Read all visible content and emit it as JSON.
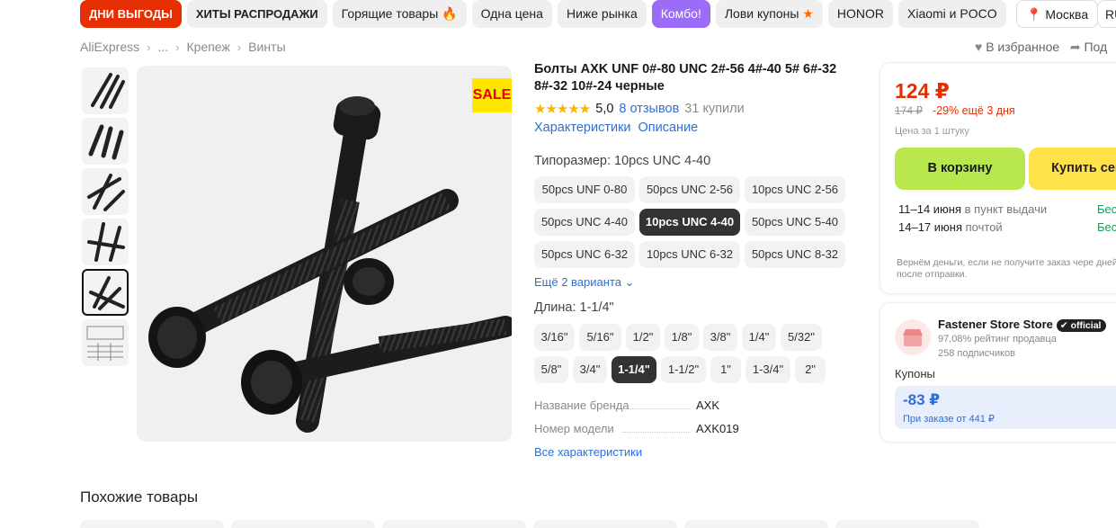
{
  "topnav": {
    "chips": [
      "ДНИ ВЫГОДЫ",
      "ХИТЫ РАСПРОДАЖИ",
      "Горящие товары",
      "Одна цена",
      "Ниже рынка",
      "Комбо!",
      "Лови купоны",
      "HONOR",
      "Xiaomi и POCO"
    ],
    "location": "Москва",
    "lang": "RU"
  },
  "breadcrumb": [
    "AliExpress",
    "...",
    "Крепеж",
    "Винты"
  ],
  "actions": {
    "favorite": "В избранное",
    "share": "Под"
  },
  "gallery": {
    "sale_badge": "SALE",
    "thumb_count": 6,
    "active_thumb": 4
  },
  "product": {
    "title": "Болты AXK UNF 0#-80 UNC 2#-56 4#-40 5# 6#-32 8#-32 10#-24 черные",
    "rating_stars": "★★★★★",
    "rating": "5,0",
    "reviews": "8 отзывов",
    "bought": "31 купили",
    "tabs": [
      "Характеристики",
      "Описание"
    ]
  },
  "size": {
    "label": "Типоразмер: 10pcs UNC 4-40",
    "options": [
      "50pcs UNF 0-80",
      "50pcs UNC 2-56",
      "10pcs UNC 2-56",
      "50pcs UNC 4-40",
      "10pcs UNC 4-40",
      "50pcs UNC 5-40",
      "50pcs UNC 6-32",
      "10pcs UNC 6-32",
      "50pcs UNC 8-32"
    ],
    "selected": 4,
    "more": "Ещё 2 варианта"
  },
  "length": {
    "label": "Длина: 1-1/4\"",
    "options": [
      "3/16\"",
      "5/16\"",
      "1/2\"",
      "1/8\"",
      "3/8\"",
      "1/4\"",
      "5/32\"",
      "5/8\"",
      "3/4\"",
      "1-1/4\"",
      "1-1/2\"",
      "1\"",
      "1-3/4\"",
      "2\""
    ],
    "selected": 9
  },
  "specs": [
    {
      "name": "Название бренда",
      "value": "AXK"
    },
    {
      "name": "Номер модели",
      "value": "AXK019"
    }
  ],
  "all_specs": "Все характеристики",
  "buy": {
    "price": "124 ₽",
    "old_price": "174 ₽",
    "discount": "-29% ещё 3 дня",
    "per_unit": "Цена за 1 штуку",
    "cart_button": "В корзину",
    "buy_now": "Купить сей",
    "delivery": [
      {
        "date": "11–14 июня",
        "method": "в пункт выдачи",
        "cost": "Бес"
      },
      {
        "date": "14–17 июня",
        "method": "почтой",
        "cost": "Бес"
      }
    ],
    "refund": "Вернём деньги, если не получите заказ чере дней после отправки."
  },
  "store": {
    "name": "Fastener Store Store",
    "badge": "official",
    "rating": "97,08% рейтинг продавца",
    "subscribers": "258 подписчиков",
    "coupons_label": "Купоны",
    "coupon_amount": "-83 ₽",
    "coupon_condition": "При заказе от 441 ₽"
  },
  "similar": {
    "title": "Похожие товары"
  },
  "colors": {
    "accent_red": "#e62e04",
    "link_blue": "#2d6fd7",
    "cart_green": "#b8e84e",
    "buy_yellow": "#ffe14a",
    "star": "#f8b600"
  }
}
